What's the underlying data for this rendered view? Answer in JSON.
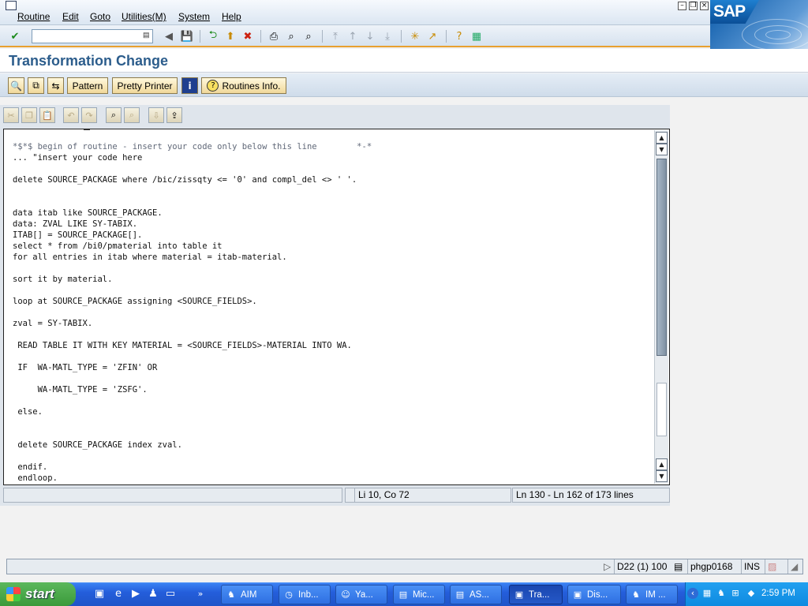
{
  "menu": {
    "items": [
      "Routine",
      "Edit",
      "Goto",
      "Utilities(M)",
      "System",
      "Help"
    ]
  },
  "sap_logo": "SAP",
  "page_title": "Transformation Change",
  "app_toolbar": {
    "pattern": "Pattern",
    "pretty_printer": "Pretty Printer",
    "routines_info": "Routines Info."
  },
  "code_lines": [
    {
      "text": "*$*$ begin of routine - insert your code only below this line        *-*",
      "comment": true
    },
    {
      "text": "... \"insert your code here",
      "comment": false
    },
    {
      "text": "",
      "comment": false
    },
    {
      "text": "delete SOURCE_PACKAGE where /bic/zissqty <= '0' and compl_del <> ' '.",
      "comment": false
    },
    {
      "text": "",
      "comment": false
    },
    {
      "text": "",
      "comment": false
    },
    {
      "text": "data itab like SOURCE_PACKAGE.",
      "comment": false
    },
    {
      "text": "data: ZVAL LIKE SY-TABIX.",
      "comment": false
    },
    {
      "text": "ITAB[] = SOURCE_PACKAGE[].",
      "comment": false
    },
    {
      "text": "select * from /bi0/pmaterial into table it",
      "comment": false
    },
    {
      "text": "for all entries in itab where material = itab-material.",
      "comment": false
    },
    {
      "text": "",
      "comment": false
    },
    {
      "text": "sort it by material.",
      "comment": false
    },
    {
      "text": "",
      "comment": false
    },
    {
      "text": "loop at SOURCE_PACKAGE assigning <SOURCE_FIELDS>.",
      "comment": false
    },
    {
      "text": "",
      "comment": false
    },
    {
      "text": "zval = SY-TABIX.",
      "comment": false
    },
    {
      "text": "",
      "comment": false
    },
    {
      "text": " READ TABLE IT WITH KEY MATERIAL = <SOURCE_FIELDS>-MATERIAL INTO WA.",
      "comment": false
    },
    {
      "text": "",
      "comment": false
    },
    {
      "text": " IF  WA-MATL_TYPE = 'ZFIN' OR",
      "comment": false
    },
    {
      "text": "",
      "comment": false
    },
    {
      "text": "     WA-MATL_TYPE = 'ZSFG'.",
      "comment": false
    },
    {
      "text": "",
      "comment": false
    },
    {
      "text": " else.",
      "comment": false
    },
    {
      "text": "",
      "comment": false
    },
    {
      "text": "",
      "comment": false
    },
    {
      "text": " delete SOURCE_PACKAGE index zval.",
      "comment": false
    },
    {
      "text": "",
      "comment": false
    },
    {
      "text": " endif.",
      "comment": false
    },
    {
      "text": " endloop.",
      "comment": false
    }
  ],
  "editor_status": {
    "position": "Li 10, Co 72",
    "lines": "Ln 130 - Ln 162 of 173 lines"
  },
  "status_bar": {
    "system": "D22 (1) 100",
    "server": "phgp0168",
    "mode": "INS"
  },
  "taskbar": {
    "start": "start",
    "tasks": [
      {
        "label": "AIM",
        "icon": "aim-icon",
        "active": false
      },
      {
        "label": "Inb...",
        "icon": "clock-icon",
        "active": false
      },
      {
        "label": "Ya...",
        "icon": "smiley-icon",
        "active": false
      },
      {
        "label": "Mic...",
        "icon": "document-icon",
        "active": false
      },
      {
        "label": "AS...",
        "icon": "document-icon",
        "active": false
      },
      {
        "label": "Tra...",
        "icon": "window-icon",
        "active": true
      },
      {
        "label": "Dis...",
        "icon": "window-icon",
        "active": false
      },
      {
        "label": "IM ...",
        "icon": "aim-icon",
        "active": false
      }
    ],
    "clock": "2:59 PM"
  },
  "colors": {
    "title": "#2c5d8c",
    "toolbar_accent": "#e8a030",
    "taskbar": "#245edb",
    "start": "#3a9a3a"
  }
}
